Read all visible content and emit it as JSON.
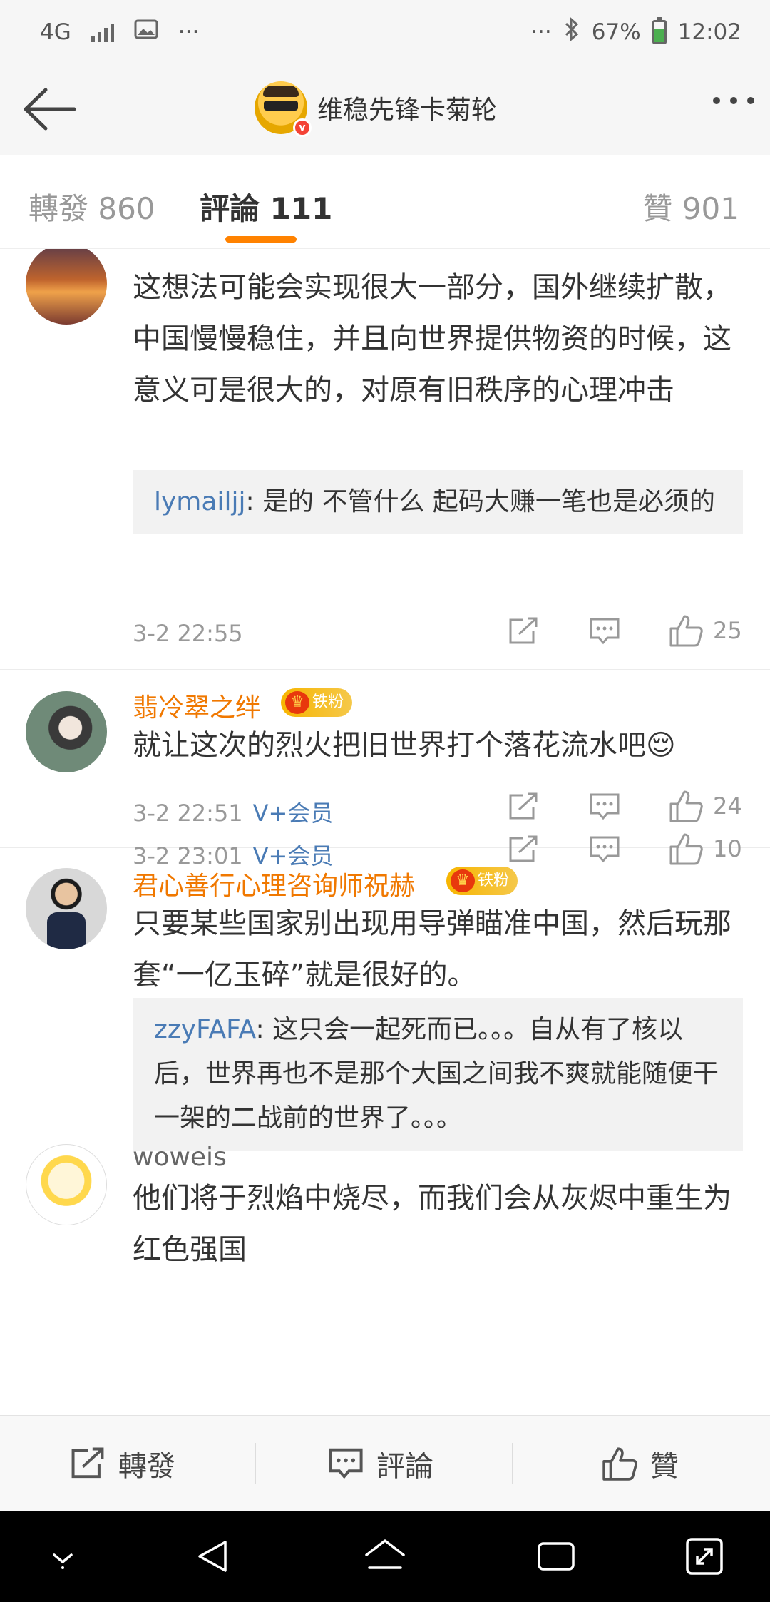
{
  "status_bar": {
    "network": "4G",
    "more": "···",
    "right_more": "···",
    "battery": "67%",
    "time": "12:02"
  },
  "header": {
    "title": "维稳先锋卡菊轮"
  },
  "tabs": {
    "repost": "轉發 860",
    "comments": "評論 111",
    "likes": "贊 901"
  },
  "comments": [
    {
      "name": "",
      "text": "这想法可能会实现很大一部分，国外继续扩散，中国慢慢稳住，并且向世界提供物资的时候，这意义可是很大的，对原有旧秩序的心理冲击",
      "reply": {
        "user": "lymailjj",
        "text": ": 是的 不管什么 起码大赚一笔也是必须的"
      },
      "time": "3-2 22:55",
      "vip": "",
      "likes": "25"
    },
    {
      "name": "翡冷翠之绊",
      "badge": "铁粉",
      "text": "就让这次的烈火把旧世界打个落花流水吧😌",
      "time": "3-2 22:51",
      "vip": "V+会员",
      "likes": "24"
    },
    {
      "name": "君心善行心理咨询师祝赫",
      "badge": "铁粉",
      "text": "只要某些国家别出现用导弹瞄准中国，然后玩那套“一亿玉碎”就是很好的。",
      "reply": {
        "user": "zzyFAFA",
        "text": ": 这只会一起死而已。。。自从有了核以后，世界再也不是那个大国之间我不爽就能随便干一架的二战前的世界了。。。"
      },
      "time": "3-2 23:01",
      "vip": "V+会员",
      "likes": "10"
    },
    {
      "name": "woweis",
      "text": "他们将于烈焰中烧尽，而我们会从灰烬中重生为红色强国"
    }
  ],
  "bottom_bar": {
    "repost": "轉發",
    "comment": "評論",
    "like": "贊"
  },
  "colors": {
    "accent": "#ff8200",
    "username": "#f07800",
    "link": "#4a7bb5"
  }
}
